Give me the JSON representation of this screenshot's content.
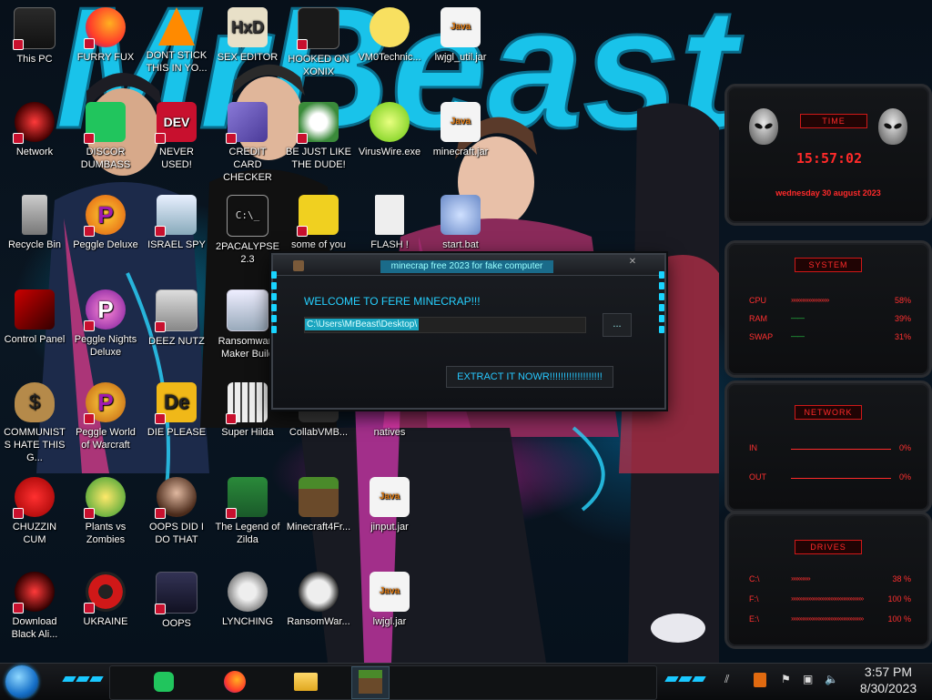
{
  "desktop": {
    "icons": [
      {
        "label": "This PC",
        "icon": "computer-icon"
      },
      {
        "label": "FURRY FUX",
        "icon": "firefox-icon"
      },
      {
        "label": "DONT STICK THIS IN YO...",
        "icon": "vlc-cone-icon"
      },
      {
        "label": "SEX EDITOR",
        "icon": "hxd-editor-icon"
      },
      {
        "label": "HOOKED ON XONIX",
        "icon": "xonix-game-icon"
      },
      {
        "label": "VM0Technic...",
        "icon": "cartoon-face-icon"
      },
      {
        "label": "lwjgl_util.jar",
        "icon": "java-jar-icon"
      },
      {
        "label": "Network",
        "icon": "network-icon"
      },
      {
        "label": "DISCOR DUMBASS",
        "icon": "chat-app-icon"
      },
      {
        "label": "NEVER USED!",
        "icon": "dev-cpp-icon"
      },
      {
        "label": "CREDIT CARD CHECKER",
        "icon": "credit-card-icon"
      },
      {
        "label": "BE JUST LIKE THE DUDE!",
        "icon": "santa-icon"
      },
      {
        "label": "VirusWire.exe",
        "icon": "lime-icon"
      },
      {
        "label": "minecraft.jar",
        "icon": "java-jar-icon"
      },
      {
        "label": "Recycle Bin",
        "icon": "recycle-bin-icon"
      },
      {
        "label": "Peggle Deluxe",
        "icon": "peggle-icon"
      },
      {
        "label": "ISRAEL SPY",
        "icon": "network-monitor-icon"
      },
      {
        "label": "2PACALYPSE 2.3",
        "icon": "terminal-icon"
      },
      {
        "label": "some of you",
        "icon": "dog-icon"
      },
      {
        "label": "FLASH !",
        "icon": "flash-document-icon"
      },
      {
        "label": "start.bat",
        "icon": "batch-gear-icon"
      },
      {
        "label": "Control Panel",
        "icon": "control-panel-icon"
      },
      {
        "label": "Peggle Nights Deluxe",
        "icon": "peggle-icon"
      },
      {
        "label": "DEEZ NUTZ",
        "icon": "stacked-windows-icon"
      },
      {
        "label": "Ransomware Maker Build",
        "icon": "window-app-icon"
      },
      {
        "label": "COMMUNISTS HATE THIS G...",
        "icon": "money-bag-icon"
      },
      {
        "label": "Peggle World of Warcraft",
        "icon": "peggle-icon"
      },
      {
        "label": "DIE PLEASE",
        "icon": "de-icon"
      },
      {
        "label": "Super Hilda",
        "icon": "pixel-sprite-icon"
      },
      {
        "label": "CollabVMB...",
        "icon": "collab-icon"
      },
      {
        "label": "natives",
        "icon": "folder-icon"
      },
      {
        "label": "CHUZZIN CUM",
        "icon": "chuzzle-icon"
      },
      {
        "label": "Plants vs Zombies",
        "icon": "plant-icon"
      },
      {
        "label": "OOPS DID I DO THAT",
        "icon": "portrait-icon"
      },
      {
        "label": "The Legend of Zilda",
        "icon": "pixel-hero-icon"
      },
      {
        "label": "Minecraft4Fr...",
        "icon": "minecraft-block-icon"
      },
      {
        "label": "jinput.jar",
        "icon": "java-jar-icon"
      },
      {
        "label": "Download Black Ali...",
        "icon": "alienware-icon"
      },
      {
        "label": "UKRAINE",
        "icon": "radiation-icon"
      },
      {
        "label": "OOPS",
        "icon": "book-icon"
      },
      {
        "label": "LYNCHING",
        "icon": "network-globe-icon"
      },
      {
        "label": "RansomWar...",
        "icon": "skull-icon"
      },
      {
        "label": "lwjgl.jar",
        "icon": "java-jar-icon"
      }
    ]
  },
  "dialog": {
    "title": "minecrap free 2023 for fake computer",
    "welcome": "WELCOME TO FERE MINECRAP!!!",
    "path": "C:\\Users\\MrBeast\\Desktop\\",
    "browse_label": "...",
    "extract_label": "EXTRACT IT NOWR!!!!!!!!!!!!!!!!!!!"
  },
  "gadget": {
    "time": {
      "header": "TIME",
      "clock": "15:57:02",
      "date": "wednesday 30 august 2023"
    },
    "system": {
      "header": "SYSTEM",
      "rows": [
        {
          "label": "CPU",
          "value": "58%"
        },
        {
          "label": "RAM",
          "value": "39%"
        },
        {
          "label": "SWAP",
          "value": "31%"
        }
      ]
    },
    "network": {
      "header": "NETWORK",
      "rows": [
        {
          "label": "IN",
          "value": "0%"
        },
        {
          "label": "OUT",
          "value": "0%"
        }
      ]
    },
    "drives": {
      "header": "DRIVES",
      "rows": [
        {
          "label": "C:\\",
          "value": "38 %"
        },
        {
          "label": "F:\\",
          "value": "100 %"
        },
        {
          "label": "E:\\",
          "value": "100 %"
        }
      ]
    },
    "accent_color": "#ff2a2a"
  },
  "taskbar": {
    "apps": [
      "chat-app-icon",
      "firefox-icon",
      "file-explorer-icon",
      "minecraft-block-icon"
    ],
    "tray_icons": [
      "java-tray-icon",
      "flag-icon",
      "network-tray-icon",
      "volume-icon"
    ],
    "time": "3:57 PM",
    "date": "8/30/2023"
  },
  "wallpaper": {
    "text": "MrBeast"
  }
}
